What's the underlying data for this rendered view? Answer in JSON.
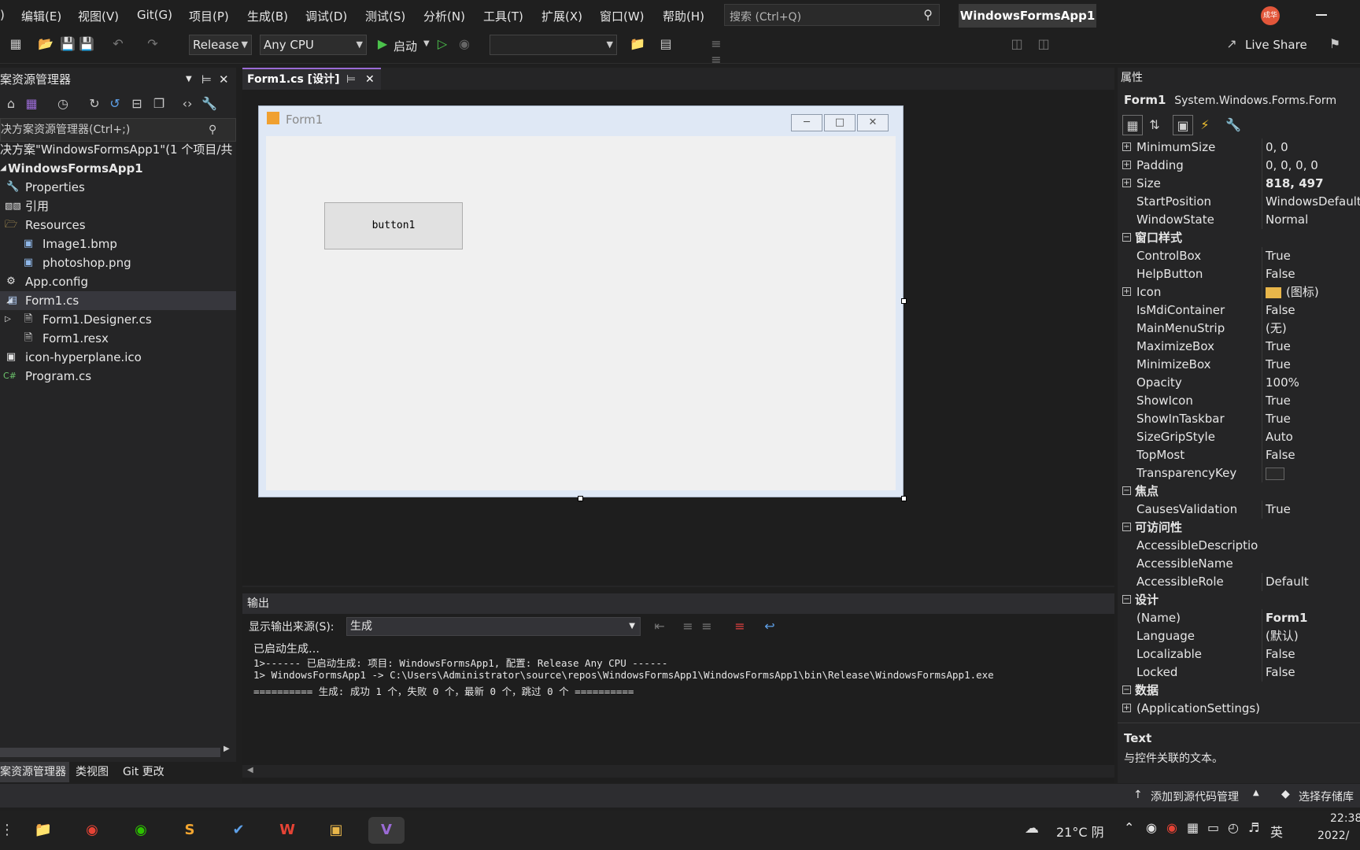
{
  "menu": [
    "编辑(E)",
    "视图(V)",
    "Git(G)",
    "项目(P)",
    "生成(B)",
    "调试(D)",
    "测试(S)",
    "分析(N)",
    "工具(T)",
    "扩展(X)",
    "窗口(W)",
    "帮助(H)"
  ],
  "search": {
    "placeholder": "搜索 (Ctrl+Q)"
  },
  "app_title": "WindowsFormsApp1",
  "avatar": "成华",
  "toolbar": {
    "config": "Release",
    "platform": "Any CPU",
    "start_label": "启动",
    "live_share": "Live Share"
  },
  "solution": {
    "header": "案资源管理器",
    "search_placeholder": "决方案资源管理器(Ctrl+;)",
    "items": [
      {
        "label": "决方案\"WindowsFormsApp1\"(1 个项目/共",
        "indent": 0
      },
      {
        "label": "WindowsFormsApp1",
        "indent": 1,
        "bold": true
      },
      {
        "label": "Properties",
        "indent": 1
      },
      {
        "label": "引用",
        "indent": 1
      },
      {
        "label": "Resources",
        "indent": 1
      },
      {
        "label": "Image1.bmp",
        "indent": 2
      },
      {
        "label": "photoshop.png",
        "indent": 2
      },
      {
        "label": "App.config",
        "indent": 1
      },
      {
        "label": "Form1.cs",
        "indent": 1,
        "selected": true
      },
      {
        "label": "Form1.Designer.cs",
        "indent": 2
      },
      {
        "label": "Form1.resx",
        "indent": 2
      },
      {
        "label": "icon-hyperplane.ico",
        "indent": 1
      },
      {
        "label": "Program.cs",
        "indent": 1
      }
    ],
    "tabs": [
      "案资源管理器",
      "类视图",
      "Git 更改"
    ]
  },
  "document": {
    "tab": "Form1.cs [设计]",
    "form_title": "Form1",
    "button_text": "button1"
  },
  "output": {
    "header": "输出",
    "source_label": "显示输出来源(S):",
    "source_value": "生成",
    "lines": [
      "已启动生成…",
      "1>------ 已启动生成: 项目: WindowsFormsApp1, 配置: Release Any CPU ------",
      "1>  WindowsFormsApp1 -> C:\\Users\\Administrator\\source\\repos\\WindowsFormsApp1\\WindowsFormsApp1\\bin\\Release\\WindowsFormsApp1.exe",
      "========== 生成: 成功 1 个，失败 0 个，最新 0 个，跳过 0 个 =========="
    ]
  },
  "properties": {
    "header": "属性",
    "object_name": "Form1",
    "object_type": "System.Windows.Forms.Form",
    "rows": [
      {
        "name": "MinimumSize",
        "value": "0, 0",
        "expand": true
      },
      {
        "name": "Padding",
        "value": "0, 0, 0, 0",
        "expand": true
      },
      {
        "name": "Size",
        "value": "818, 497",
        "expand": true,
        "bold": true
      },
      {
        "name": "StartPosition",
        "value": "WindowsDefaultL"
      },
      {
        "name": "WindowState",
        "value": "Normal"
      },
      {
        "name": "窗口样式",
        "category": true
      },
      {
        "name": "ControlBox",
        "value": "True"
      },
      {
        "name": "HelpButton",
        "value": "False"
      },
      {
        "name": "Icon",
        "value": "(图标)",
        "expand": true
      },
      {
        "name": "IsMdiContainer",
        "value": "False"
      },
      {
        "name": "MainMenuStrip",
        "value": "(无)"
      },
      {
        "name": "MaximizeBox",
        "value": "True"
      },
      {
        "name": "MinimizeBox",
        "value": "True"
      },
      {
        "name": "Opacity",
        "value": "100%"
      },
      {
        "name": "ShowIcon",
        "value": "True"
      },
      {
        "name": "ShowInTaskbar",
        "value": "True"
      },
      {
        "name": "SizeGripStyle",
        "value": "Auto"
      },
      {
        "name": "TopMost",
        "value": "False"
      },
      {
        "name": "TransparencyKey",
        "value": ""
      },
      {
        "name": "焦点",
        "category": true
      },
      {
        "name": "CausesValidation",
        "value": "True"
      },
      {
        "name": "可访问性",
        "category": true
      },
      {
        "name": "AccessibleDescriptio",
        "value": ""
      },
      {
        "name": "AccessibleName",
        "value": ""
      },
      {
        "name": "AccessibleRole",
        "value": "Default"
      },
      {
        "name": "设计",
        "category": true
      },
      {
        "name": "(Name)",
        "value": "Form1",
        "bold": true
      },
      {
        "name": "Language",
        "value": "(默认)"
      },
      {
        "name": "Localizable",
        "value": "False"
      },
      {
        "name": "Locked",
        "value": "False"
      },
      {
        "name": "数据",
        "category": true
      },
      {
        "name": "(ApplicationSettings)",
        "value": "",
        "expand": true
      }
    ],
    "desc_title": "Text",
    "desc_text": "与控件关联的文本。"
  },
  "statusbar": {
    "add_source": "添加到源代码管理",
    "select_repo": "选择存储库"
  },
  "taskbar": {
    "weather": "21°C 阴",
    "ime": "英",
    "time": "22:38",
    "date": "2022/"
  }
}
